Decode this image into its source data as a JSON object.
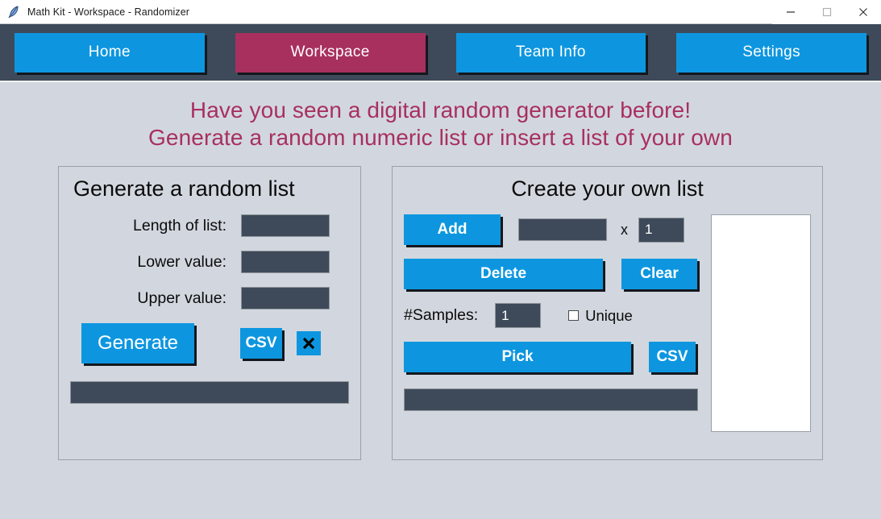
{
  "window": {
    "title": "Math Kit - Workspace - Randomizer",
    "icon": "feather-quill-icon",
    "controls": {
      "minimize": "minimize-icon",
      "maximize": "maximize-icon",
      "close": "close-icon"
    }
  },
  "nav": {
    "items": [
      {
        "label": "Home",
        "active": false
      },
      {
        "label": "Workspace",
        "active": true
      },
      {
        "label": "Team Info",
        "active": false
      },
      {
        "label": "Settings",
        "active": false
      }
    ],
    "active_color": "#a8305e",
    "inactive_color": "#0d96df",
    "bar_color": "#3e4a59"
  },
  "headline": {
    "line1": "Have you seen a digital random generator before!",
    "line2": "Generate a random numeric list or insert a list of your own",
    "color": "#a8305e"
  },
  "generate_panel": {
    "title": "Generate a random list",
    "fields": [
      {
        "label": "Length of list:",
        "value": ""
      },
      {
        "label": "Lower value:",
        "value": ""
      },
      {
        "label": "Upper value:",
        "value": ""
      }
    ],
    "generate_label": "Generate",
    "csv_label": "CSV",
    "clear_icon": "x-icon",
    "status_text": ""
  },
  "create_panel": {
    "title": "Create your own list",
    "add_label": "Add",
    "add_value": "",
    "multiplier_symbol": "x",
    "multiplier_value": "1",
    "delete_label": "Delete",
    "clear_label": "Clear",
    "samples_label": "#Samples:",
    "samples_value": "1",
    "unique_label": "Unique",
    "unique_checked": false,
    "pick_label": "Pick",
    "csv_label": "CSV",
    "status_text": "",
    "list_items": []
  },
  "theme": {
    "background": "#d2d7df",
    "accent_blue": "#0d96df",
    "accent_magenta": "#a8305e",
    "dark_field": "#3e4a59"
  }
}
